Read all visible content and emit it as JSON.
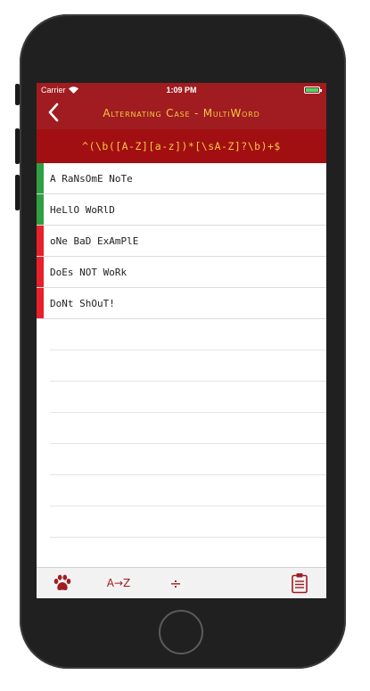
{
  "status_bar": {
    "carrier": "Carrier",
    "time": "1:09 PM",
    "battery_color": "#4cd964"
  },
  "nav": {
    "back_icon": "chevron-left-icon",
    "title": "Alternating Case - MultiWord"
  },
  "regex": "^(\\b([A-Z][a-z])*[\\sA-Z]?\\b)+$",
  "colors": {
    "brand": "#a01c20",
    "accent_text": "#f4c842",
    "match": "#2ea043",
    "no_match": "#e8202a"
  },
  "test_strings": [
    {
      "text": "A RaNsOmE NoTe",
      "matches": true
    },
    {
      "text": "HeLlO WoRlD",
      "matches": true
    },
    {
      "text": "oNe BaD ExAmPlE",
      "matches": false
    },
    {
      "text": "DoEs NOT WoRk",
      "matches": false
    },
    {
      "text": "DoNt ShOuT!",
      "matches": false
    }
  ],
  "tabs": {
    "paw_icon": "paw-icon",
    "az_label": "A→Z",
    "divide_label": "÷",
    "clipboard_icon": "clipboard-icon"
  }
}
